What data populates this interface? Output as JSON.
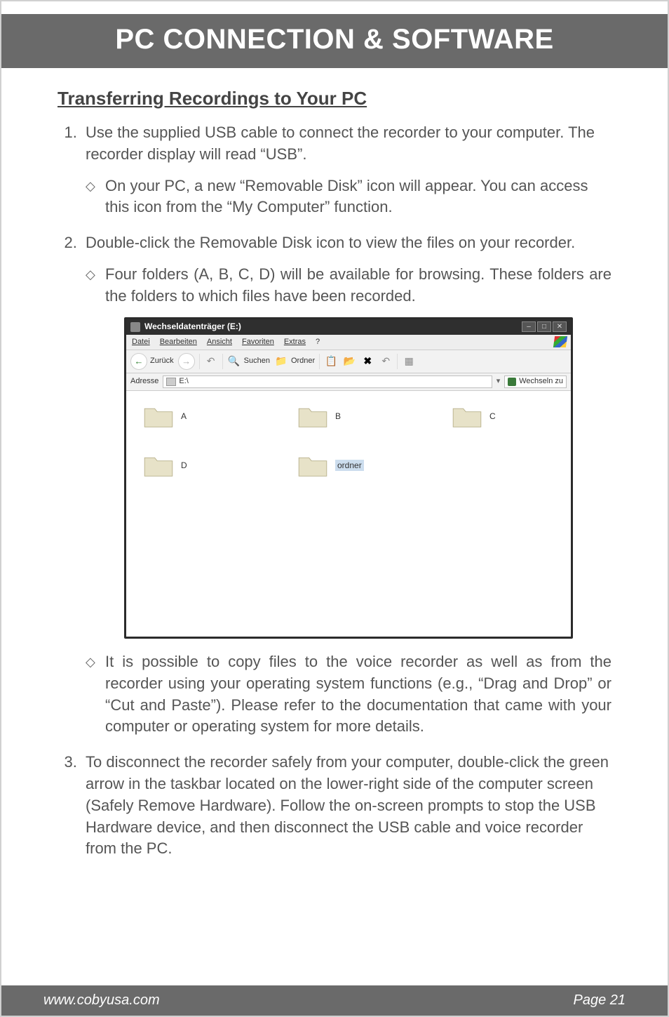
{
  "header": {
    "title": "PC CONNECTION & SOFTWARE"
  },
  "section": {
    "title": "Transferring Recordings to Your PC"
  },
  "list": {
    "item1": {
      "text": "Use the supplied USB cable to connect the recorder to your computer. The recorder display will read “USB”.",
      "sub1": "On your PC, a new “Removable Disk” icon will appear. You can access this icon from the “My Computer” function."
    },
    "item2": {
      "text": "Double-click the Removable Disk icon to view the files on your recorder.",
      "sub1": "Four folders (A, B, C, D) will be available for browsing. These folders are the folders to which files have been recorded.",
      "sub2": "It is possible to copy files to the voice recorder as well as from the recorder using your operating system functions (e.g., “Drag and Drop” or “Cut and Paste”). Please refer to the documentation that came with your computer or operating system for more details."
    },
    "item3": {
      "text": "To disconnect the recorder safely from your computer, double-click the green arrow in the taskbar located on the lower-right side of the computer screen (Safely Remove Hardware). Follow the on-screen prompts to stop the USB Hardware device, and then disconnect the USB cable and voice recorder from the PC."
    }
  },
  "screenshot": {
    "window_title": "Wechseldatenträger (E:)",
    "menus": {
      "m1": "Datei",
      "m2": "Bearbeiten",
      "m3": "Ansicht",
      "m4": "Favoriten",
      "m5": "Extras",
      "m6": "?"
    },
    "toolbar": {
      "back": "Zurück",
      "search": "Suchen",
      "folders": "Ordner"
    },
    "addressbar": {
      "label": "Adresse",
      "value": "E:\\",
      "go": "Wechseln zu"
    },
    "folders": {
      "a": "A",
      "b": "B",
      "c": "C",
      "d": "D",
      "e": "ordner"
    },
    "controls": {
      "min": "–",
      "max": "□",
      "close": "✕"
    }
  },
  "footer": {
    "url": "www.cobyusa.com",
    "page": "Page 21"
  }
}
